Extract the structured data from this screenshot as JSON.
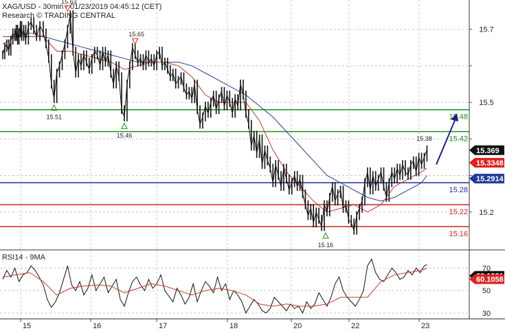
{
  "header": {
    "line1": "XAG/USD - 30min - 01/23/2019 04:45:12 (CET)",
    "line2": "Research © TRADING CENTRAL"
  },
  "colors": {
    "price": "#111111",
    "ma_fast": "#c0392b",
    "ma_slow": "#2c3e8f",
    "support_red": "#cc2222",
    "level_green": "#1e8f1e",
    "level_blue": "#1f2f9a",
    "arrow": "#1a237e",
    "badge_dark": "#111111",
    "badge_red": "#dd2222",
    "badge_blue": "#1f3a9a",
    "grid": "#c8c8c8"
  },
  "chart_data": [
    {
      "type": "line",
      "panel": "price",
      "x_labels": [
        "15",
        "16",
        "17",
        "18",
        "20",
        "22",
        "23"
      ],
      "ylim": [
        15.1,
        15.78
      ],
      "y_ticks": [
        15.2,
        15.3,
        15.4,
        15.5,
        15.6,
        15.7
      ],
      "y_tick_labels": [
        "15.2",
        "",
        "",
        "15.5",
        "",
        "15.7"
      ],
      "series": [
        {
          "name": "price",
          "x": [
            0,
            3,
            6,
            9,
            12,
            15,
            18,
            20,
            22,
            24,
            26,
            28,
            31,
            34,
            38,
            42,
            46,
            50,
            55,
            60,
            64,
            68,
            72,
            76,
            80,
            84,
            88,
            92,
            96,
            100,
            104,
            108,
            112,
            116,
            120,
            124,
            128,
            132,
            136,
            140,
            144,
            148,
            152,
            156,
            160,
            164,
            168,
            172,
            176,
            180,
            184,
            188,
            192,
            196,
            200,
            204,
            208,
            212,
            216,
            220,
            224,
            228,
            232,
            236,
            240,
            244,
            248,
            252,
            256,
            260,
            264,
            268,
            272,
            276,
            280,
            284,
            288,
            292,
            296,
            300,
            304,
            308,
            312,
            316,
            320,
            324,
            328,
            332,
            336,
            340,
            344,
            348,
            352,
            356,
            360,
            364,
            368,
            372,
            376,
            380,
            384,
            388,
            392,
            396,
            400,
            404,
            408,
            412,
            416,
            420,
            424,
            428,
            432,
            436,
            440,
            444,
            448,
            452,
            456,
            460,
            464,
            468,
            472,
            476,
            480,
            484,
            488,
            492,
            496,
            500,
            504,
            508,
            512,
            516,
            520,
            524,
            528,
            532,
            536,
            540,
            544,
            548,
            552,
            556,
            560,
            564,
            568,
            572,
            576,
            580,
            584,
            588,
            592,
            596,
            600,
            604,
            608,
            612,
            616,
            620,
            624,
            628
          ],
          "values": [
            15.63,
            15.65,
            15.66,
            15.64,
            15.67,
            15.69,
            15.68,
            15.7,
            15.67,
            15.69,
            15.71,
            15.68,
            15.7,
            15.67,
            15.71,
            15.72,
            15.7,
            15.68,
            15.71,
            15.69,
            15.66,
            15.62,
            15.55,
            15.51,
            15.58,
            15.6,
            15.63,
            15.66,
            15.7,
            15.74,
            15.64,
            15.58,
            15.62,
            15.6,
            15.63,
            15.61,
            15.59,
            15.62,
            15.64,
            15.63,
            15.6,
            15.64,
            15.61,
            15.63,
            15.58,
            15.55,
            15.6,
            15.57,
            15.48,
            15.46,
            15.55,
            15.6,
            15.65,
            15.63,
            15.61,
            15.62,
            15.6,
            15.63,
            15.61,
            15.62,
            15.6,
            15.63,
            15.64,
            15.6,
            15.61,
            15.59,
            15.57,
            15.58,
            15.55,
            15.56,
            15.57,
            15.54,
            15.52,
            15.53,
            15.51,
            15.55,
            15.48,
            15.44,
            15.46,
            15.49,
            15.47,
            15.5,
            15.52,
            15.48,
            15.51,
            15.53,
            15.49,
            15.52,
            15.5,
            15.47,
            15.51,
            15.49,
            15.55,
            15.52,
            15.47,
            15.44,
            15.38,
            15.41,
            15.36,
            15.4,
            15.33,
            15.37,
            15.34,
            15.32,
            15.28,
            15.33,
            15.3,
            15.27,
            15.32,
            15.29,
            15.26,
            15.28,
            15.3,
            15.27,
            15.29,
            15.25,
            15.22,
            15.19,
            15.21,
            15.17,
            15.2,
            15.18,
            15.16,
            15.22,
            15.2,
            15.24,
            15.27,
            15.23,
            15.25,
            15.26,
            15.21,
            15.22,
            15.18,
            15.17,
            15.15,
            15.19,
            15.21,
            15.23,
            15.28,
            15.31,
            15.26,
            15.3,
            15.27,
            15.29,
            15.31,
            15.27,
            15.24,
            15.28,
            15.31,
            15.29,
            15.32,
            15.3,
            15.33,
            15.31,
            15.3,
            15.33,
            15.34,
            15.31,
            15.35,
            15.33,
            15.35,
            15.37
          ]
        },
        {
          "name": "ma_fast",
          "x": [
            0,
            20,
            40,
            60,
            80,
            100,
            120,
            140,
            160,
            180,
            200,
            220,
            240,
            260,
            280,
            300,
            320,
            340,
            360,
            380,
            400,
            420,
            440,
            460,
            480,
            500,
            520,
            540,
            560,
            580,
            600,
            620,
            628
          ],
          "values": [
            15.66,
            15.68,
            15.69,
            15.68,
            15.64,
            15.64,
            15.63,
            15.62,
            15.61,
            15.59,
            15.6,
            15.61,
            15.61,
            15.6,
            15.57,
            15.52,
            15.5,
            15.5,
            15.5,
            15.45,
            15.37,
            15.31,
            15.27,
            15.23,
            15.2,
            15.21,
            15.22,
            15.2,
            15.22,
            15.27,
            15.29,
            15.31,
            15.32
          ]
        },
        {
          "name": "ma_slow",
          "x": [
            0,
            20,
            40,
            60,
            80,
            100,
            120,
            140,
            160,
            180,
            200,
            220,
            240,
            260,
            280,
            300,
            320,
            340,
            360,
            380,
            400,
            420,
            440,
            460,
            480,
            500,
            520,
            540,
            560,
            580,
            600,
            620,
            628
          ],
          "values": [
            15.68,
            15.68,
            15.68,
            15.68,
            15.67,
            15.66,
            15.65,
            15.64,
            15.63,
            15.62,
            15.61,
            15.61,
            15.61,
            15.61,
            15.6,
            15.58,
            15.56,
            15.54,
            15.52,
            15.49,
            15.46,
            15.42,
            15.38,
            15.34,
            15.3,
            15.28,
            15.26,
            15.24,
            15.23,
            15.24,
            15.26,
            15.28,
            15.3
          ]
        }
      ],
      "levels": [
        {
          "value": 15.48,
          "label": "15.48",
          "role": "green"
        },
        {
          "value": 15.42,
          "label": "15.42",
          "role": "green"
        },
        {
          "value": 15.28,
          "label": "15.28",
          "role": "blue"
        },
        {
          "value": 15.22,
          "label": "15.22",
          "role": "red"
        },
        {
          "value": 15.16,
          "label": "15.16",
          "role": "red"
        }
      ],
      "annotations": [
        {
          "x": 76,
          "value": 15.51,
          "label": "15.51",
          "marker": "up"
        },
        {
          "x": 180,
          "value": 15.46,
          "label": "15.46",
          "marker": "up"
        },
        {
          "x": 96,
          "value": 15.74,
          "label": "15.63",
          "marker": "down"
        },
        {
          "x": 196,
          "value": 15.65,
          "label": "15.65",
          "marker": "down"
        },
        {
          "x": 478,
          "value": 15.16,
          "label": "15.16",
          "marker": "up"
        },
        {
          "x": 624,
          "value": 15.38,
          "label": "15.38",
          "marker": "none"
        }
      ],
      "badges": [
        {
          "value": 15.369,
          "label": "15.369",
          "role": "dark"
        },
        {
          "value": 15.3348,
          "label": "15.3348",
          "role": "red"
        },
        {
          "value": 15.2914,
          "label": "15.2914",
          "role": "blue"
        }
      ],
      "arrow": {
        "from": [
          635,
          15.33
        ],
        "to": [
          665,
          15.47
        ]
      }
    },
    {
      "type": "line",
      "panel": "rsi",
      "title": "RSI14 - 9MA",
      "ylim": [
        25,
        85
      ],
      "y_ticks": [
        30,
        50,
        70
      ],
      "y_tick_labels": [
        "30",
        "50",
        "70"
      ],
      "series": [
        {
          "name": "rsi",
          "x": [
            0,
            6,
            12,
            18,
            24,
            30,
            36,
            42,
            48,
            54,
            60,
            66,
            72,
            78,
            84,
            90,
            96,
            102,
            108,
            114,
            120,
            126,
            132,
            138,
            144,
            150,
            156,
            162,
            168,
            174,
            180,
            186,
            192,
            198,
            204,
            210,
            216,
            222,
            228,
            234,
            240,
            246,
            252,
            258,
            264,
            270,
            276,
            282,
            288,
            294,
            300,
            306,
            312,
            318,
            324,
            330,
            336,
            342,
            348,
            354,
            360,
            366,
            372,
            378,
            384,
            390,
            396,
            402,
            408,
            414,
            420,
            426,
            432,
            438,
            444,
            450,
            456,
            462,
            468,
            474,
            480,
            486,
            492,
            498,
            504,
            510,
            516,
            522,
            528,
            534,
            540,
            546,
            552,
            558,
            564,
            570,
            576,
            582,
            588,
            594,
            600,
            606,
            612,
            618,
            624,
            628
          ],
          "values": [
            60,
            68,
            62,
            70,
            58,
            64,
            66,
            72,
            68,
            62,
            55,
            42,
            35,
            40,
            48,
            60,
            72,
            55,
            50,
            58,
            46,
            52,
            64,
            50,
            56,
            62,
            48,
            54,
            60,
            42,
            36,
            48,
            58,
            62,
            55,
            50,
            60,
            52,
            56,
            64,
            50,
            45,
            40,
            52,
            46,
            38,
            44,
            56,
            40,
            50,
            58,
            54,
            48,
            62,
            50,
            56,
            42,
            50,
            46,
            40,
            30,
            36,
            42,
            38,
            32,
            30,
            34,
            44,
            40,
            36,
            32,
            38,
            34,
            36,
            30,
            40,
            34,
            38,
            48,
            42,
            36,
            44,
            56,
            62,
            50,
            44,
            40,
            36,
            42,
            50,
            72,
            78,
            66,
            60,
            58,
            64,
            70,
            66,
            60,
            62,
            68,
            64,
            70,
            66,
            72,
            73
          ]
        },
        {
          "name": "rsi_ma",
          "x": [
            0,
            20,
            40,
            60,
            80,
            100,
            120,
            140,
            160,
            180,
            200,
            220,
            240,
            260,
            280,
            300,
            320,
            340,
            360,
            380,
            400,
            420,
            440,
            460,
            480,
            500,
            520,
            540,
            560,
            580,
            600,
            620,
            628
          ],
          "values": [
            62,
            64,
            66,
            58,
            46,
            52,
            54,
            55,
            54,
            48,
            52,
            56,
            54,
            50,
            46,
            50,
            52,
            50,
            46,
            38,
            36,
            38,
            36,
            36,
            38,
            44,
            44,
            44,
            58,
            64,
            66,
            68,
            70
          ]
        }
      ],
      "badges": [
        {
          "value": 63.1281,
          "label": "63.1281",
          "role": "dark"
        },
        {
          "value": 60.1058,
          "label": "60.1058",
          "role": "red"
        }
      ]
    }
  ]
}
